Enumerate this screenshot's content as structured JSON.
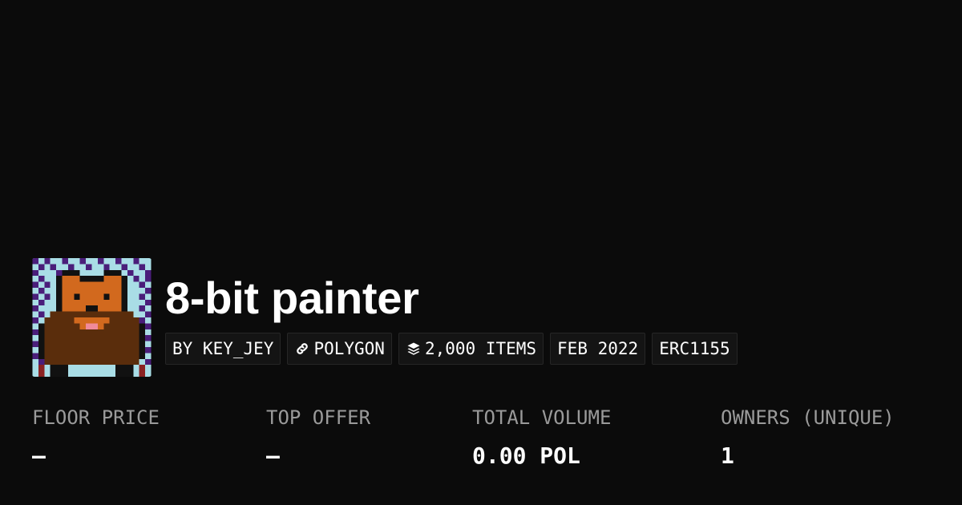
{
  "collection": {
    "name": "8-bit painter",
    "avatar_alt": "pixel-art bear avatar"
  },
  "chips": {
    "creator": "BY KEY_JEY",
    "chain": "POLYGON",
    "items": "2,000 ITEMS",
    "date": "FEB 2022",
    "standard": "ERC1155"
  },
  "stats": {
    "floor_price": {
      "label": "FLOOR PRICE",
      "value": "–"
    },
    "top_offer": {
      "label": "TOP OFFER",
      "value": "–"
    },
    "total_volume": {
      "label": "TOTAL VOLUME",
      "value": "0.00 POL"
    },
    "owners": {
      "label": "OWNERS (UNIQUE)",
      "value": "1"
    }
  },
  "colors": {
    "background": "#0b0b0b",
    "chip_bg": "#141414",
    "chip_border": "#262626",
    "label": "#9a9a9a",
    "text": "#ffffff"
  }
}
